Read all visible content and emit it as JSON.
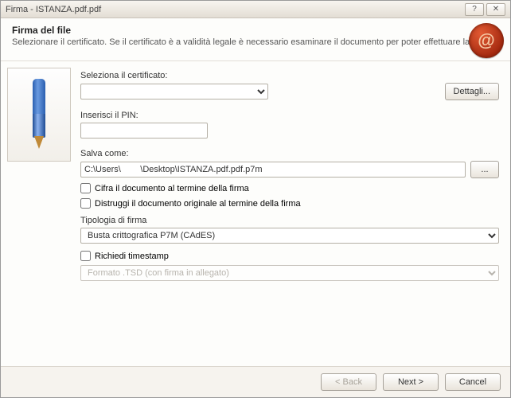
{
  "window": {
    "title": "Firma - ISTANZA.pdf.pdf"
  },
  "header": {
    "title": "Firma del file",
    "subtitle": "Selezionare il certificato. Se il certificato è a validità legale è necessario esaminare il documento per poter effettuare la firma"
  },
  "form": {
    "cert_label": "Seleziona il certificato:",
    "cert_value": "",
    "dettagli_label": "Dettagli...",
    "pin_label": "Inserisci il PIN:",
    "pin_value": "",
    "save_label": "Salva come:",
    "save_value": "C:\\Users\\        \\Desktop\\ISTANZA.pdf.pdf.p7m",
    "browse_label": "...",
    "chk_cifra": "Cifra il documento al termine della firma",
    "chk_distruggi": "Distruggi il documento originale al termine della firma",
    "tipologia_label": "Tipologia di firma",
    "tipologia_value": "Busta crittografica P7M (CAdES)",
    "chk_timestamp": "Richiedi timestamp",
    "ts_format_value": "Formato .TSD (con firma in allegato)"
  },
  "footer": {
    "back": "< Back",
    "next": "Next >",
    "cancel": "Cancel"
  }
}
